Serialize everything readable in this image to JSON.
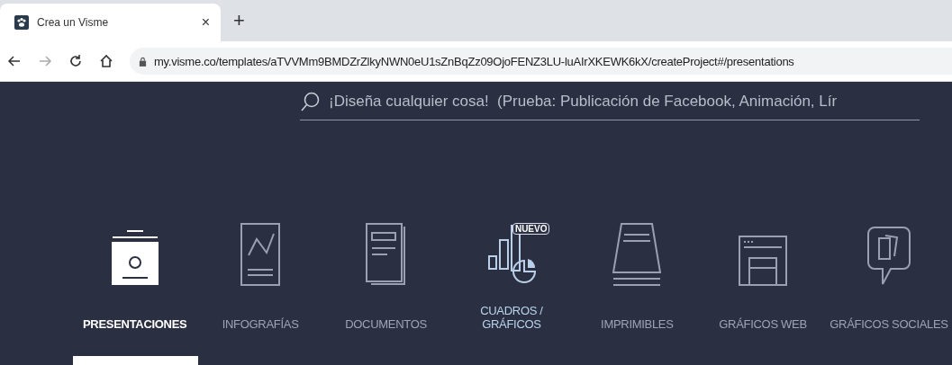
{
  "browser": {
    "tab": {
      "title": "Crea un Visme",
      "close": "×"
    },
    "new_tab": "+",
    "address": "my.visme.co/templates/aTVVMm9BMDZrZlkyNWN0eU1sZnBqZz09OjoFENZ3LU-luAIrXKEWK6kX/createProject#/presentations"
  },
  "search": {
    "placeholder": "¡Diseña cualquier cosa!  (Prueba: Publicación de Facebook, Animación, Lír"
  },
  "categories": [
    {
      "kind": "presentation",
      "label": "PRESENTACIONES",
      "selected": true
    },
    {
      "kind": "infographic",
      "label": "INFOGRAFÍAS",
      "selected": false
    },
    {
      "kind": "document",
      "label": "DOCUMENTOS",
      "selected": false
    },
    {
      "kind": "chart",
      "label": "CUADROS / GRÁFICOS",
      "selected": false,
      "badge": "NUEVO"
    },
    {
      "kind": "printable",
      "label": "IMPRIMIBLES",
      "selected": false
    },
    {
      "kind": "web",
      "label": "GRÁFICOS WEB",
      "selected": false
    },
    {
      "kind": "social",
      "label": "GRÁFICOS SOCIALES",
      "selected": false
    }
  ]
}
